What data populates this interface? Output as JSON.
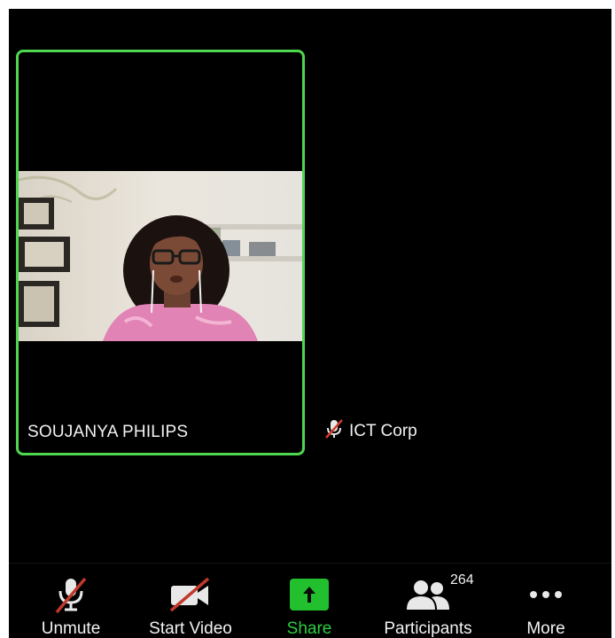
{
  "participants": {
    "active": {
      "name": "SOUJANYA PHILIPS"
    },
    "other": {
      "name": "ICT Corp"
    }
  },
  "toolbar": {
    "unmute_label": "Unmute",
    "start_video_label": "Start Video",
    "share_label": "Share",
    "participants_label": "Participants",
    "participants_count": "264",
    "more_label": "More"
  },
  "colors": {
    "active_speaker_border": "#4fd64f",
    "share_green": "#22c02e",
    "mute_slash": "#c0392b"
  },
  "icons": [
    "mic-off-icon",
    "video-off-icon",
    "share-arrow-icon",
    "participants-icon",
    "more-dots-icon"
  ]
}
